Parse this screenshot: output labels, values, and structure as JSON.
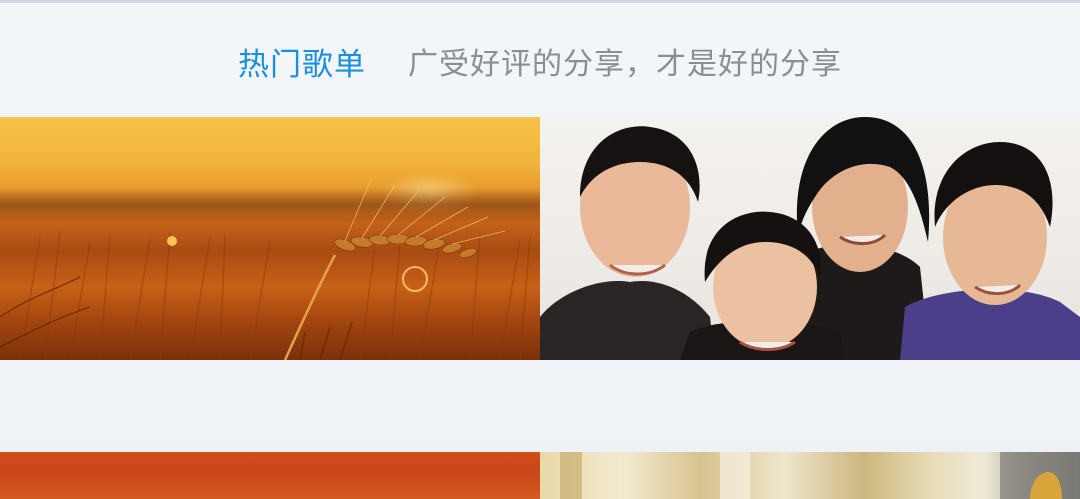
{
  "section": {
    "title": "热门歌单",
    "subtitle": "广受好评的分享，才是好的分享"
  },
  "playlists": [
    {
      "image": "wheat-field-sunset"
    },
    {
      "image": "band-group-portrait"
    },
    {
      "image": "orange-sunset"
    },
    {
      "image": "sunlit-room"
    }
  ]
}
